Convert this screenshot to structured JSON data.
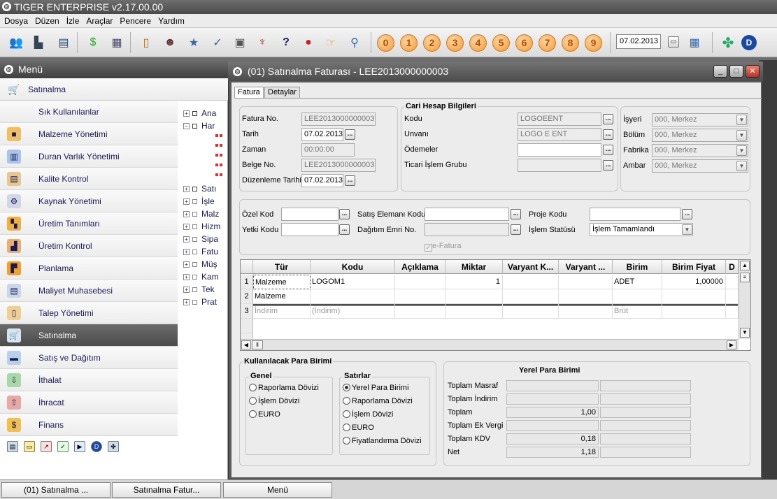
{
  "app": {
    "title": "TIGER ENTERPRISE v2.17.00.00"
  },
  "menubar": [
    "Dosya",
    "Düzen",
    "İzle",
    "Araçlar",
    "Pencere",
    "Yardım"
  ],
  "toolbar": {
    "icons": [
      "users-icon",
      "chart-building-icon",
      "window-list-icon",
      "money-icon",
      "calculator-icon",
      "clipboard-icon",
      "person-icon",
      "document-star-icon",
      "graph-check-icon",
      "report-icon",
      "antenna-icon",
      "help-icon",
      "chat-icon",
      "hand-cursor-icon",
      "magnifier-icon"
    ],
    "numbers": [
      "0",
      "1",
      "2",
      "3",
      "4",
      "5",
      "6",
      "7",
      "8",
      "9"
    ],
    "date": "07.02.2013"
  },
  "menu": {
    "title": "Menü",
    "section": "Satınalma",
    "items": [
      {
        "label": "Sık Kullanılanlar",
        "icon": ""
      },
      {
        "label": "Malzeme Yönetimi",
        "icon": "box-icon"
      },
      {
        "label": "Duran Varlık Yönetimi",
        "icon": "building-icon"
      },
      {
        "label": "Kalite Kontrol",
        "icon": "quality-icon"
      },
      {
        "label": "Kaynak Yönetimi",
        "icon": "gear-icon"
      },
      {
        "label": "Üretim Tanımları",
        "icon": "flow-icon"
      },
      {
        "label": "Üretim Kontrol",
        "icon": "factory-icon"
      },
      {
        "label": "Planlama",
        "icon": "plan-icon"
      },
      {
        "label": "Maliyet Muhasebesi",
        "icon": "cost-icon"
      },
      {
        "label": "Talep Yönetimi",
        "icon": "request-icon"
      },
      {
        "label": "Satınalma",
        "icon": "cart-icon"
      },
      {
        "label": "Satış ve Dağıtım",
        "icon": "truck-icon"
      },
      {
        "label": "İthalat",
        "icon": "import-icon"
      },
      {
        "label": "İhracat",
        "icon": "export-icon"
      },
      {
        "label": "Finans",
        "icon": "finance-icon"
      }
    ],
    "tree": [
      "Ana",
      "Har",
      "Satı",
      "İşle",
      "Malz",
      "Hizm",
      "Sipa",
      "Fatu",
      "Müş",
      "Kam",
      "Tek",
      "Prat"
    ]
  },
  "taskbar": [
    "(01) Satınalma ...",
    "Satınalma Fatur...",
    "Menü"
  ],
  "dialog": {
    "title": "(01) Satınalma Faturası - LEE2013000000003",
    "tabs": [
      "Fatura",
      "Detaylar"
    ],
    "header": {
      "fatura_no_label": "Fatura No.",
      "fatura_no": "LEE2013000000003",
      "tarih_label": "Tarih",
      "tarih": "07.02.2013",
      "zaman_label": "Zaman",
      "zaman": "00:00:00",
      "belge_no_label": "Belge No.",
      "belge_no": "LEE2013000000003",
      "duzenleme_label": "Düzenleme Tarihi",
      "duzenleme": "07.02.2013"
    },
    "cari": {
      "title": "Cari Hesap Bilgileri",
      "kodu_label": "Kodu",
      "kodu": "LOGOEENT",
      "unvani_label": "Unvanı",
      "unvani": "LOGO E ENT",
      "odemeler_label": "Ödemeler",
      "odemeler": "",
      "ticari_label": "Ticari İşlem Grubu",
      "ticari": ""
    },
    "org": {
      "isyeri_label": "İşyeri",
      "isyeri": "000, Merkez",
      "bolum_label": "Bölüm",
      "bolum": "000, Merkez",
      "fabrika_label": "Fabrika",
      "fabrika": "000, Merkez",
      "ambar_label": "Ambar",
      "ambar": "000, Merkez"
    },
    "extra": {
      "ozel_kod_label": "Özel Kod",
      "yetki_kodu_label": "Yetki Kodu",
      "satis_elemani_label": "Satış Elemanı Kodu",
      "dagitim_label": "Dağıtım Emri No.",
      "proje_kodu_label": "Proje Kodu",
      "islem_statusu_label": "İşlem Statüsü",
      "islem_statusu": "İşlem Tamamlandı",
      "efatura_label": "e-Fatura"
    },
    "grid": {
      "columns": [
        "Tür",
        "Kodu",
        "Açıklama",
        "Miktar",
        "Varyant K...",
        "Varyant ...",
        "Birim",
        "Birim Fiyat",
        "D"
      ],
      "rows": [
        {
          "n": "1",
          "tur": "Malzeme",
          "kodu": "LOGOM1",
          "aciklama": "",
          "miktar": "1",
          "vk": "",
          "va": "",
          "birim": "ADET",
          "fiyat": "1,00000"
        },
        {
          "n": "2",
          "tur": "Malzeme",
          "kodu": "",
          "aciklama": "",
          "miktar": "",
          "vk": "",
          "va": "",
          "birim": "",
          "fiyat": ""
        },
        {
          "n": "3",
          "tur": "İndirim",
          "kodu": "(İndirim)",
          "aciklama": "",
          "miktar": "",
          "vk": "",
          "va": "",
          "birim": "Brüt",
          "fiyat": ""
        }
      ]
    },
    "currency": {
      "title": "Kullanılacak Para Birimi",
      "genel_label": "Genel",
      "genel": [
        "Raporlama Dövizi",
        "İşlem Dövizi",
        "EURO"
      ],
      "satirlar_label": "Satırlar",
      "satirlar": [
        "Yerel Para Birimi",
        "Raporlama Dövizi",
        "İşlem Dövizi",
        "EURO",
        "Fiyatlandırma Dövizi"
      ],
      "satirlar_selected": 0
    },
    "totals": {
      "title": "Yerel Para Birimi",
      "rows": [
        {
          "label": "Toplam Masraf",
          "value": ""
        },
        {
          "label": "Toplam İndirim",
          "value": ""
        },
        {
          "label": "Toplam",
          "value": "1,00"
        },
        {
          "label": "Toplam Ek Vergi",
          "value": ""
        },
        {
          "label": "Toplam KDV",
          "value": "0,18"
        },
        {
          "label": "Net",
          "value": "1,18"
        }
      ]
    }
  }
}
